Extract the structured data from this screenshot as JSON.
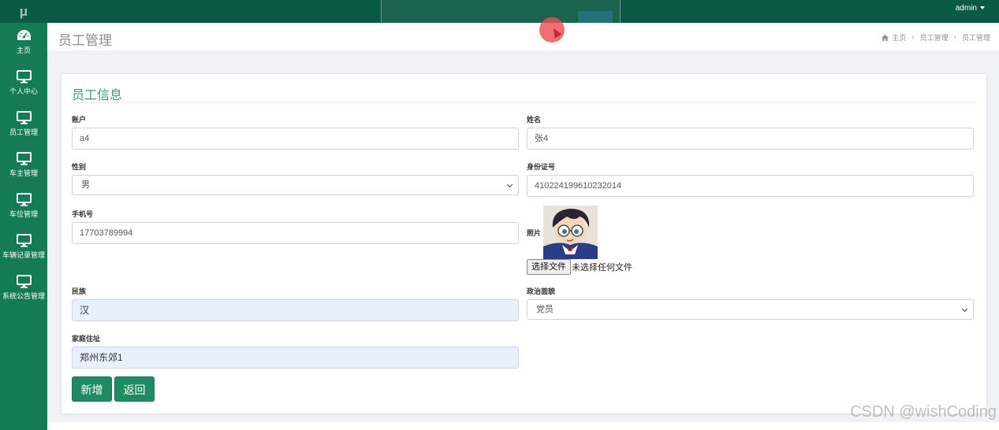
{
  "app": {
    "logo_text": "μ"
  },
  "topbar": {
    "user": "admin"
  },
  "sidebar": {
    "items": [
      {
        "label": "主页",
        "icon": "dashboard-icon"
      },
      {
        "label": "个人中心",
        "icon": "monitor-icon"
      },
      {
        "label": "员工管理",
        "icon": "monitor-icon"
      },
      {
        "label": "车主管理",
        "icon": "monitor-icon"
      },
      {
        "label": "车位管理",
        "icon": "monitor-icon"
      },
      {
        "label": "车辆记录管理",
        "icon": "monitor-icon"
      },
      {
        "label": "系统公告管理",
        "icon": "monitor-icon"
      }
    ]
  },
  "header": {
    "title": "员工管理",
    "breadcrumb": [
      "主页",
      "员工管理",
      "员工管理"
    ]
  },
  "form": {
    "title": "员工信息",
    "account": {
      "label": "账户",
      "value": "a4"
    },
    "name": {
      "label": "姓名",
      "value": "张4"
    },
    "gender": {
      "label": "性别",
      "value": "男"
    },
    "id_card": {
      "label": "身份证号",
      "value": "410224199610232014"
    },
    "phone": {
      "label": "手机号",
      "value": "17703789994"
    },
    "photo": {
      "label": "照片",
      "choose_button": "选择文件",
      "no_file": "未选择任何文件"
    },
    "ethnicity": {
      "label": "民族",
      "value": "汉"
    },
    "political": {
      "label": "政治面貌",
      "value": "党员"
    },
    "address": {
      "label": "家庭住址",
      "value": "郑州东郊1"
    },
    "buttons": {
      "submit": "新增",
      "back": "返回"
    }
  },
  "watermark": "CSDN @wishCoding",
  "colors": {
    "topbar": "#0b5a45",
    "sidebar": "#157a56",
    "accent": "#1f8a64",
    "title": "#3f9a72"
  }
}
